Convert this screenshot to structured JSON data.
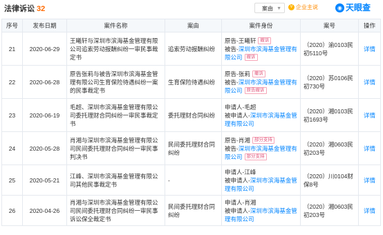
{
  "header": {
    "title": "法律诉讼",
    "count": "32",
    "reason_dropdown": "案由",
    "vip_label": "企业主说",
    "brand": "天眼查"
  },
  "columns": [
    "序号",
    "发布日期",
    "案件名称",
    "案由",
    "案件身份",
    "案号",
    "操作"
  ],
  "rows": [
    {
      "no": "21",
      "date": "2020-06-29",
      "name": "王曦轩与深圳市滨海基金管理有限公司追索劳动报酬纠纷一审民事裁定书",
      "reason": "追索劳动报酬纠纷",
      "parties": [
        {
          "role": "原告-王曦轩",
          "tag": "撤诉"
        },
        {
          "role": "被告-",
          "link": "深圳市滨海基金管理有限公司",
          "tag": "撤诉"
        }
      ],
      "case_no": "（2020）渝0103民初5110号",
      "action": "详情"
    },
    {
      "no": "22",
      "date": "2020-06-28",
      "name": "原告张莉与被告深圳市滨海基金管理有限公司生育保险待遇纠纷一案的民事裁定书",
      "reason": "生育保险待遇纠纷",
      "parties": [
        {
          "role": "原告-张莉",
          "tag": "撤诉"
        },
        {
          "role": "被告-",
          "link": "深圳市滨海基金管理有限公司",
          "tag": "原告撤诉"
        }
      ],
      "case_no": "（2020）苏0106民初730号",
      "action": "详情"
    },
    {
      "no": "23",
      "date": "2020-06-19",
      "name": "毛超、深圳市滨海基金管理有限公司委托理财合同纠纷一审民事裁定书",
      "reason": "委托理财合同纠纷",
      "parties": [
        {
          "role": "申请人-毛超"
        },
        {
          "role": "被申请人-",
          "link": "深圳市滨海基金管理有限公司"
        }
      ],
      "case_no": "（2020）湘0103民初1693号",
      "action": "详情"
    },
    {
      "no": "24",
      "date": "2020-05-28",
      "name": "肖湘与深圳市滨海基金管理有限公司民间委托理财合同纠纷一审民事判决书",
      "reason": "民间委托理财合同纠纷",
      "parties": [
        {
          "role": "原告-肖湘",
          "tag": "部分支持"
        },
        {
          "role": "被告-",
          "link": "深圳市滨海基金管理有限公司",
          "tag": "部分支持"
        }
      ],
      "case_no": "（2020）湘0603民初203号",
      "action": "详情"
    },
    {
      "no": "25",
      "date": "2020-05-21",
      "name": "江峰、深圳市滨海基金管理有限公司其他民事裁定书",
      "reason": "-",
      "parties": [
        {
          "role": "申请人-江峰"
        },
        {
          "role": "被申请人-",
          "link": "深圳市滨海基金管理有限公司"
        }
      ],
      "case_no": "（2020）川0104财保8号",
      "action": "详情"
    },
    {
      "no": "26",
      "date": "2020-04-26",
      "name": "肖湘与深圳市滨海基金管理有限公司民间委托理财合同纠纷一审民事诉讼保全裁定书",
      "reason": "民间委托理财合同纠纷",
      "parties": [
        {
          "role": "申请人-肖湘"
        },
        {
          "role": "被申请人-",
          "link": "深圳市滨海基金管理有限公司"
        }
      ],
      "case_no": "（2020）湘0603民初203号",
      "action": "详情"
    }
  ]
}
